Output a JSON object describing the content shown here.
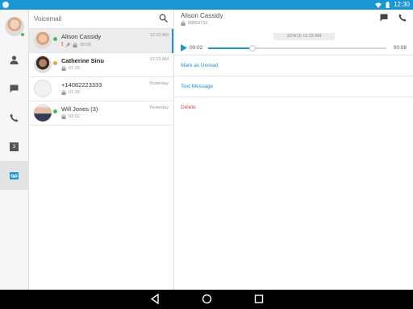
{
  "status_bar": {
    "time": "12:30",
    "colors": {
      "background": "#1996d3"
    }
  },
  "rail": {
    "items": [
      {
        "icon": "contacts-icon"
      },
      {
        "icon": "chat-icon"
      },
      {
        "icon": "phone-icon"
      },
      {
        "icon": "calendar-icon",
        "badge": "3"
      },
      {
        "icon": "voicemail-icon",
        "active": true
      }
    ]
  },
  "list": {
    "title": "Voicemail",
    "items": [
      {
        "name": "Alison Cassidy",
        "time": "12:22 AM",
        "duration": "00:08",
        "presence": "#4cbb4f",
        "urgent": "!",
        "selected": true
      },
      {
        "name": "Catherine Sinu",
        "time": "12:22 AM",
        "duration": "01:29",
        "presence": "#f2a22a"
      },
      {
        "name": "+14082223333",
        "time": "Yesterday",
        "duration": "01:29"
      },
      {
        "name": "Will Jones (3)",
        "time": "Yesterday",
        "duration": "01:02",
        "presence": "#4cbb4f"
      }
    ]
  },
  "detail": {
    "name": "Alison Cassidy",
    "number": "88856732",
    "date": "3/24/15 12:22 AM",
    "player": {
      "current": "00:02",
      "total": "00:08",
      "progress": 0.25
    },
    "actions": {
      "mark_unread": "Mark as Unread",
      "text_message": "Text Message",
      "delete": "Delete"
    }
  },
  "colors": {
    "accent": "#1996d3",
    "danger": "#e2483c",
    "online": "#4cbb4f",
    "away": "#f2a22a"
  }
}
